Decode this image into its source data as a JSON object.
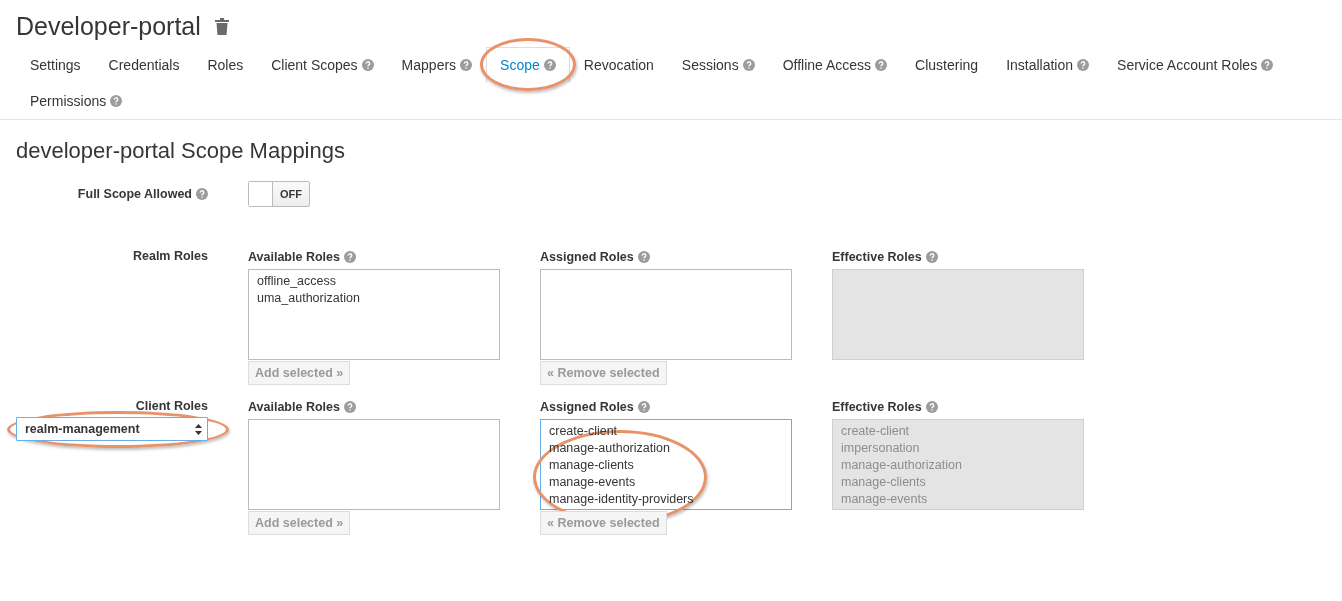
{
  "page": {
    "title": "Developer-portal"
  },
  "tabs": [
    {
      "label": "Settings",
      "help": false,
      "selected": false,
      "highlighted": false
    },
    {
      "label": "Credentials",
      "help": false,
      "selected": false,
      "highlighted": false
    },
    {
      "label": "Roles",
      "help": false,
      "selected": false,
      "highlighted": false
    },
    {
      "label": "Client Scopes",
      "help": true,
      "selected": false,
      "highlighted": false
    },
    {
      "label": "Mappers",
      "help": true,
      "selected": false,
      "highlighted": false
    },
    {
      "label": "Scope",
      "help": true,
      "selected": true,
      "highlighted": true
    },
    {
      "label": "Revocation",
      "help": false,
      "selected": false,
      "highlighted": false
    },
    {
      "label": "Sessions",
      "help": true,
      "selected": false,
      "highlighted": false
    },
    {
      "label": "Offline Access",
      "help": true,
      "selected": false,
      "highlighted": false
    },
    {
      "label": "Clustering",
      "help": false,
      "selected": false,
      "highlighted": false
    },
    {
      "label": "Installation",
      "help": true,
      "selected": false,
      "highlighted": false
    },
    {
      "label": "Service Account Roles",
      "help": true,
      "selected": false,
      "highlighted": false
    },
    {
      "label": "Permissions",
      "help": true,
      "selected": false,
      "highlighted": false
    }
  ],
  "heading": "developer-portal Scope Mappings",
  "full_scope": {
    "label": "Full Scope Allowed",
    "help": true,
    "on": false,
    "toggle_text": "OFF"
  },
  "realm_roles": {
    "label": "Realm Roles",
    "panels": [
      {
        "title": "Available Roles",
        "help": true,
        "items": [
          "offline_access",
          "uma_authorization"
        ],
        "readonly": false,
        "focused": false,
        "highlighted": false,
        "button": "Add selected »",
        "button_disabled": true
      },
      {
        "title": "Assigned Roles",
        "help": true,
        "readonly": false,
        "focused": false,
        "highlighted": false,
        "button": "« Remove selected",
        "button_disabled": true
      },
      {
        "title": "Effective Roles",
        "help": true,
        "readonly": true,
        "focused": false,
        "highlighted": false
      }
    ]
  },
  "client_roles": {
    "label": "Client Roles",
    "client_select": {
      "value": "realm-management",
      "highlighted": true
    },
    "panels": [
      {
        "title": "Available Roles",
        "help": true,
        "readonly": false,
        "focused": false,
        "highlighted": false,
        "button": "Add selected »",
        "button_disabled": true
      },
      {
        "title": "Assigned Roles",
        "help": true,
        "items": [
          "create-client",
          "manage-authorization",
          "manage-clients",
          "manage-events",
          "manage-identity-providers"
        ],
        "readonly": false,
        "focused": true,
        "highlighted": true,
        "button": "« Remove selected",
        "button_disabled": true
      },
      {
        "title": "Effective Roles",
        "help": true,
        "items": [
          "create-client",
          "impersonation",
          "manage-authorization",
          "manage-clients",
          "manage-events"
        ],
        "readonly": true,
        "focused": false,
        "highlighted": false
      }
    ]
  }
}
